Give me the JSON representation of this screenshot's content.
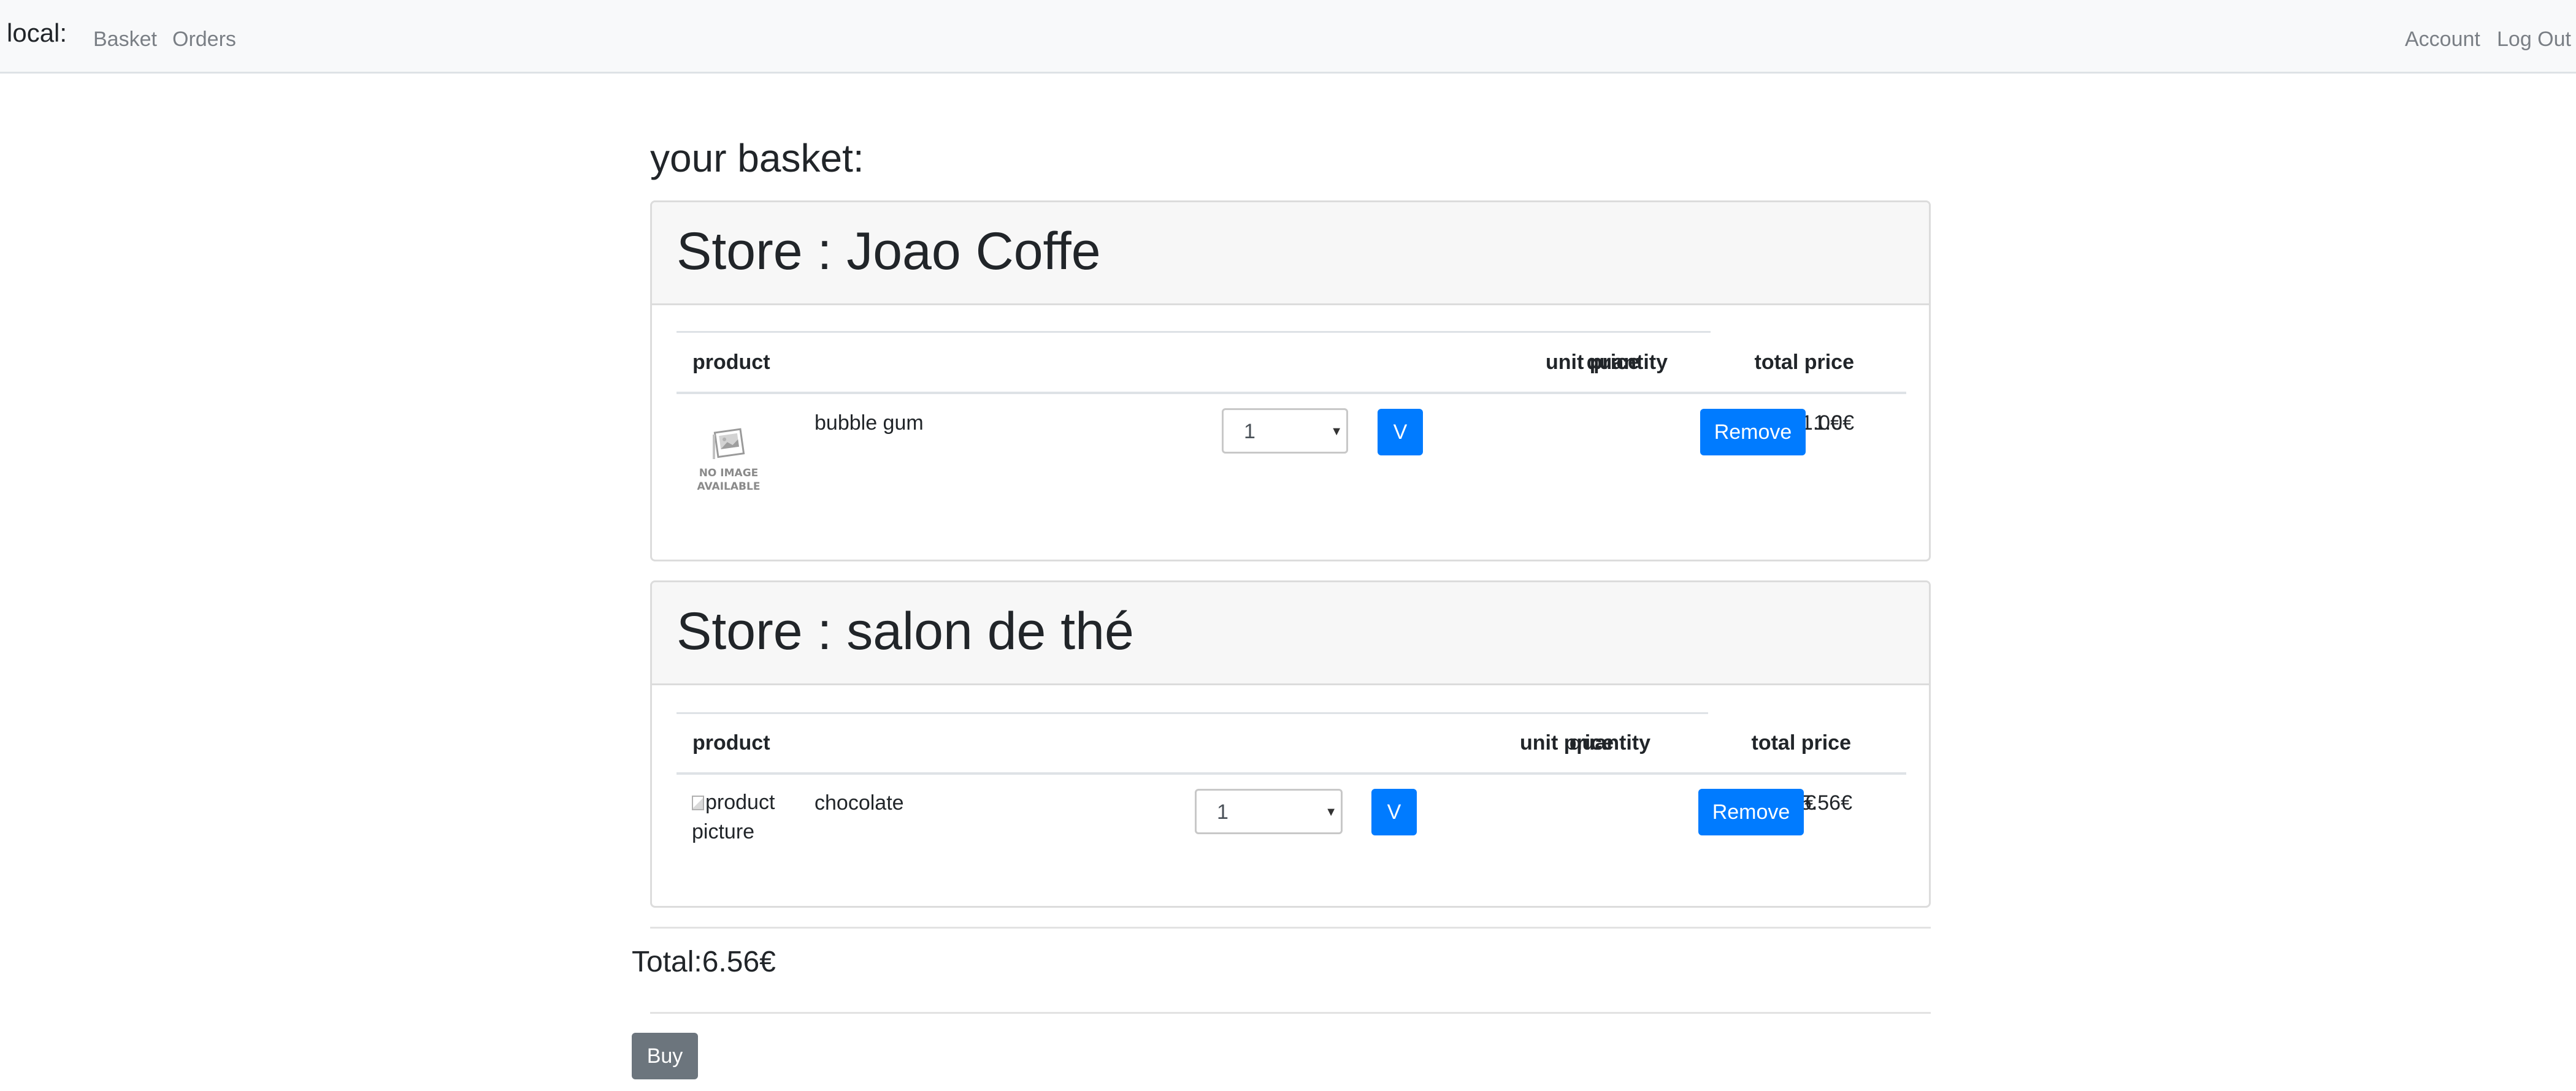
{
  "navbar": {
    "brand": "local:",
    "links": {
      "basket": "Basket",
      "orders": "Orders",
      "account": "Account",
      "logout": "Log Out"
    }
  },
  "page": {
    "title": "your basket:"
  },
  "table_headers": {
    "product": "product",
    "unit_price": "unit price",
    "quantity": "quantity",
    "total_price": "total price"
  },
  "stores": [
    {
      "title": "Store : Joao Coffe",
      "items": [
        {
          "image_text": [
            "NO IMAGE",
            "AVAILABLE"
          ],
          "name": "bubble gum",
          "unit_price": "1.0€",
          "quantity": "1",
          "confirm_label": "V",
          "total_price": "1.0€",
          "remove_label": "Remove"
        }
      ]
    },
    {
      "title": "Store : salon de thé",
      "items": [
        {
          "image_alt": "product picture",
          "name": "chocolate",
          "unit_price": "5.56€",
          "quantity": "1",
          "confirm_label": "V",
          "total_price": "5.56€",
          "remove_label": "Remove"
        }
      ]
    }
  ],
  "summary": {
    "total": "Total:6.56€",
    "buy_label": "Buy"
  },
  "colors": {
    "primary": "#007bff",
    "secondary": "#6c757d",
    "navbar_bg": "#f8f9fa",
    "card_header_bg": "#f7f7f7",
    "nav_link": "#7a7f85"
  },
  "icons": {
    "no_image": "no-image-available-icon",
    "broken_image": "broken-image-icon",
    "select_caret": "caret-down-icon"
  }
}
